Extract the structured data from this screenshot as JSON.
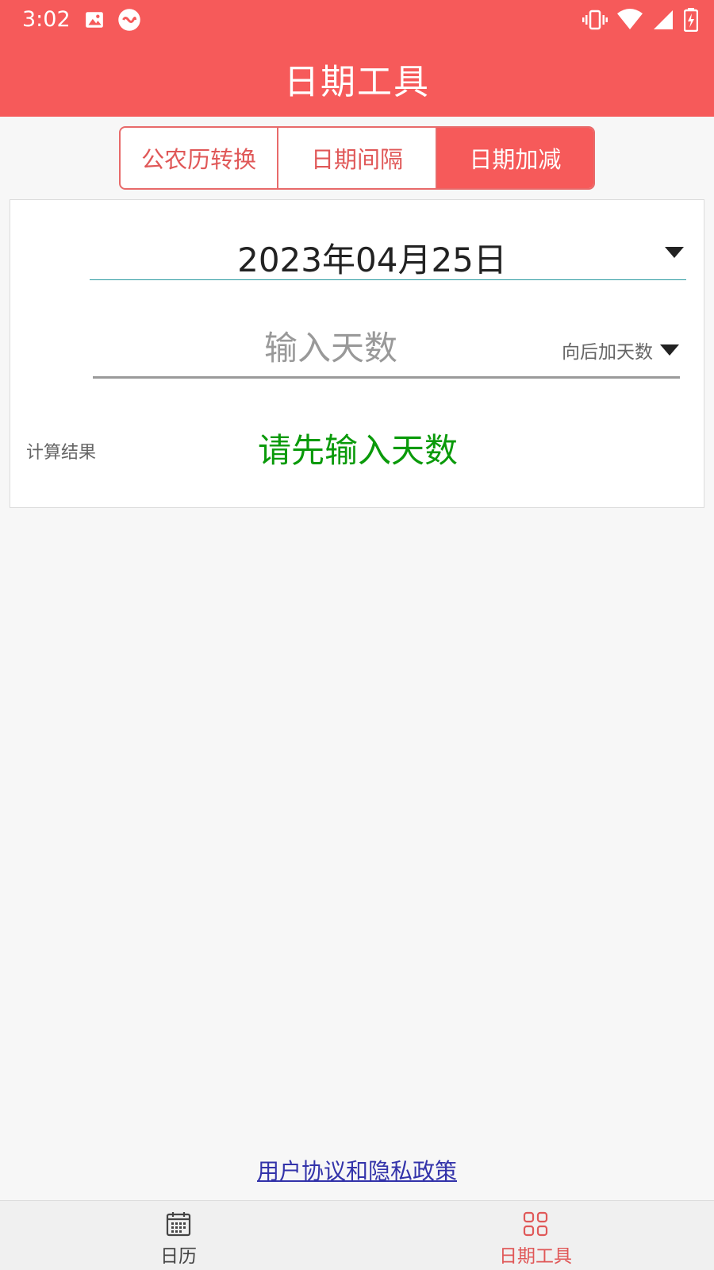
{
  "status_bar": {
    "time": "3:02",
    "left_icons": [
      "image-icon",
      "link-app-icon"
    ],
    "right_icons": [
      "vibrate-icon",
      "wifi-icon",
      "signal-icon",
      "battery-charging-icon"
    ]
  },
  "app_bar": {
    "title": "日期工具"
  },
  "tabs": [
    {
      "label": "公农历转换",
      "active": false
    },
    {
      "label": "日期间隔",
      "active": false
    },
    {
      "label": "日期加减",
      "active": true
    }
  ],
  "card": {
    "date": "2023年04月25日",
    "days_input": {
      "value": "",
      "placeholder": "输入天数"
    },
    "direction": "向后加天数",
    "result_label": "计算结果",
    "result_value": "请先输入天数"
  },
  "footer": {
    "agreement_link": "用户协议和隐私政策"
  },
  "bottom_nav": [
    {
      "label": "日历",
      "icon": "calendar-icon",
      "active": false
    },
    {
      "label": "日期工具",
      "icon": "grid-icon",
      "active": true
    }
  ],
  "colors": {
    "primary": "#f65a5a",
    "result_green": "#0a9a0a",
    "link_blue": "#3333aa",
    "date_underline": "#2a9aa0"
  }
}
